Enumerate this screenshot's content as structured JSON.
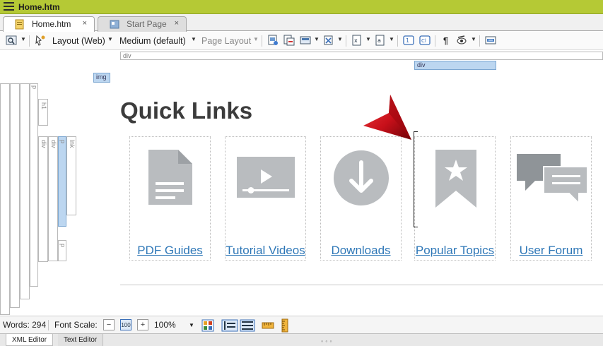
{
  "window": {
    "title": "Home.htm"
  },
  "tabs": [
    {
      "label": "Home.htm",
      "close": "×"
    },
    {
      "label": "Start Page",
      "close": "×"
    }
  ],
  "toolbar": {
    "layout": "Layout (Web)",
    "medium": "Medium (default)",
    "page_layout": "Page Layout",
    "pilcrow": "¶"
  },
  "structure": {
    "div": "div",
    "img": "img",
    "p": "p",
    "h1": "h1",
    "lnk": "lnk"
  },
  "content": {
    "heading": "Quick Links",
    "links": [
      {
        "label": "PDF Guides",
        "icon": "document-icon"
      },
      {
        "label": "Tutorial Videos",
        "icon": "video-icon"
      },
      {
        "label": "Downloads",
        "icon": "download-icon"
      },
      {
        "label": "Popular Topics",
        "icon": "bookmark-star-icon"
      },
      {
        "label": "User Forum",
        "icon": "chat-bubbles-icon"
      }
    ]
  },
  "status": {
    "words": "Words: 294",
    "font_scale_label": "Font Scale:",
    "zoom": "100%"
  },
  "bottom_tabs": {
    "xml": "XML Editor",
    "text": "Text Editor",
    "grip": "◦◦◦"
  },
  "colors": {
    "title_bar": "#b5c935",
    "link": "#2e77b7",
    "icon_gray": "#b9bcbf",
    "pointer_red": "#c8101a"
  }
}
